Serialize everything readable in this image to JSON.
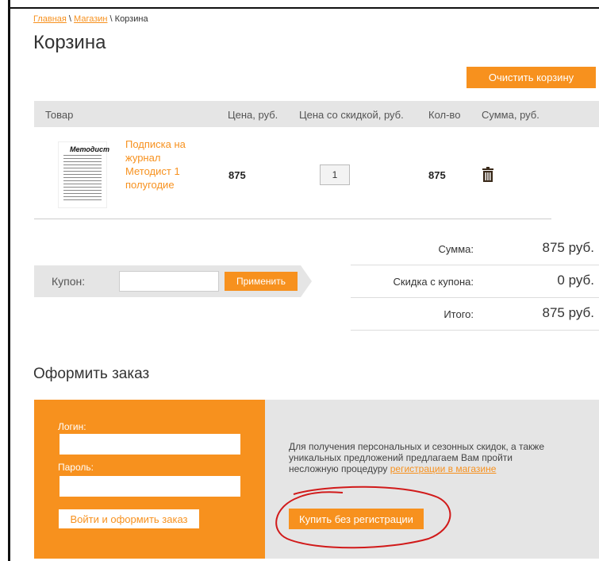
{
  "breadcrumb": {
    "home": "Главная",
    "shop": "Магазин",
    "current": "Корзина",
    "separator": " \\ "
  },
  "page": {
    "title": "Корзина"
  },
  "cart": {
    "clear_label": "Очистить корзину",
    "columns": [
      "Товар",
      "Цена, руб.",
      "Цена со скидкой, руб.",
      "Кол-во",
      "Сумма, руб."
    ],
    "items": [
      {
        "thumbnail_brand": "Методист",
        "name": "Подписка на журнал Методист 1 полугодие",
        "price": "875",
        "quantity": "1",
        "sum": "875"
      }
    ]
  },
  "coupon": {
    "label": "Купон:",
    "value": "",
    "apply_label": "Применить"
  },
  "totals": {
    "sum_label": "Сумма:",
    "sum_value": "875 руб.",
    "discount_label": "Скидка с купона:",
    "discount_value": "0 руб.",
    "total_label": "Итого:",
    "total_value": "875 руб."
  },
  "order": {
    "title": "Оформить заказ",
    "login_label": "Логин:",
    "password_label": "Пароль:",
    "login_value": "",
    "password_value": "",
    "login_button": "Войти и оформить заказ",
    "guest_text": "Для получения персональных и сезонных скидок, а также уникальных предложений предлагаем Вам пройти несложную процедуру",
    "register_link": "регистрации в магазине",
    "guest_button": "Купить без регистрации"
  },
  "colors": {
    "accent": "#f7911e",
    "panel_gray": "#e5e5e5",
    "annotation_red": "#d11a1a"
  }
}
